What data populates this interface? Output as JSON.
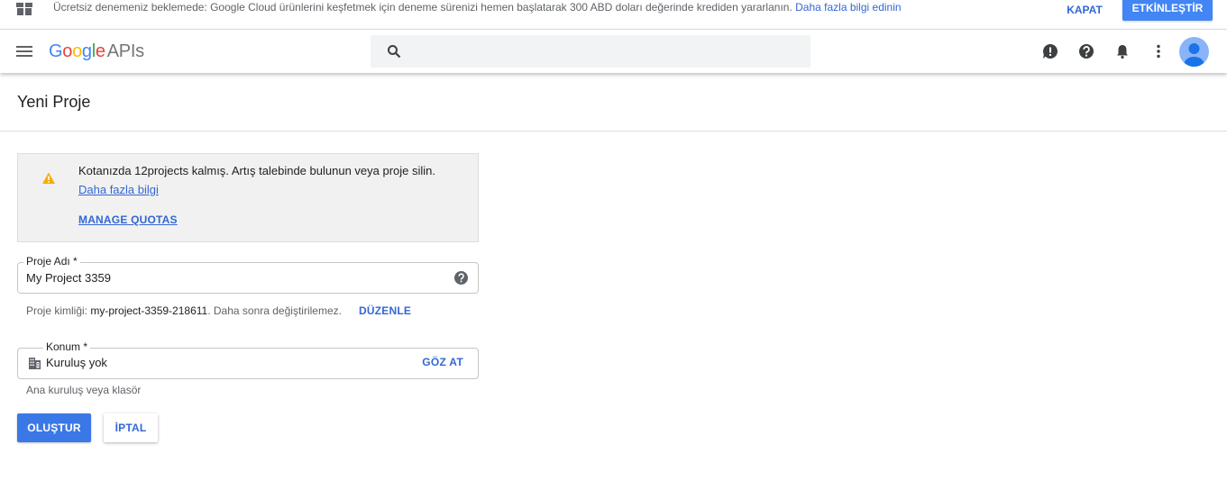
{
  "banner": {
    "message": "Ücretsiz denemeniz beklemede: Google Cloud ürünlerini keşfetmek için deneme sürenizi hemen başlatarak 300 ABD doları değerinde krediden yararlanın.",
    "link": "Daha fazla bilgi edinin",
    "dismiss_label": "KAPAT",
    "activate_label": "ETKİNLEŞTİR",
    "accent_color": "#4285f4"
  },
  "appbar": {
    "logo_google": [
      "G",
      "o",
      "o",
      "g",
      "l",
      "e"
    ],
    "logo_suffix": "APIs",
    "search_placeholder": "",
    "icons": [
      "menu-icon",
      "search-icon",
      "feedback-icon",
      "help-icon",
      "notifications-icon",
      "more-vert-icon",
      "account-avatar"
    ]
  },
  "page": {
    "title": "Yeni Proje"
  },
  "notice": {
    "text": "Kotanızda 12projects kalmış. Artış talebinde bulunun veya proje silin.",
    "learn_more": "Daha fazla bilgi",
    "manage_quotas": "MANAGE QUOTAS",
    "icon": "warning-icon",
    "icon_color": "#f9ab00"
  },
  "form": {
    "project_name": {
      "label": "Proje Adı *",
      "value": "My Project 3359"
    },
    "project_id": {
      "prefix": "Proje kimliği:",
      "value": "my-project-3359-218611",
      "suffix": ". Daha sonra değiştirilemez.",
      "edit_label": "DÜZENLE"
    },
    "location": {
      "label": "Konum *",
      "value": "Kuruluş yok",
      "browse_label": "GÖZ AT",
      "hint": "Ana kuruluş veya klasör"
    },
    "create_label": "OLUŞTUR",
    "cancel_label": "İPTAL"
  }
}
